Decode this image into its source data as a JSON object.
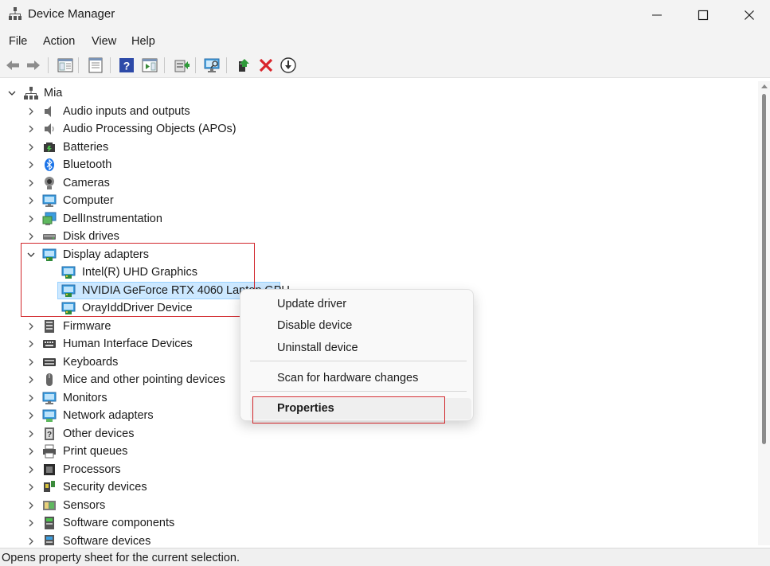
{
  "window": {
    "title": "Device Manager"
  },
  "menu": [
    "File",
    "Action",
    "View",
    "Help"
  ],
  "toolbar": {
    "buttons": [
      "back-arrow-icon",
      "forward-arrow-icon",
      "show-hide-console-tree-icon",
      "properties-sheet-icon",
      "help-icon",
      "action-pane-icon",
      "update-driver-icon",
      "scan-hardware-icon",
      "enable-device-icon",
      "uninstall-x-icon",
      "disable-down-icon"
    ]
  },
  "tree": {
    "root": "Mia",
    "categories": [
      "Audio inputs and outputs",
      "Audio Processing Objects (APOs)",
      "Batteries",
      "Bluetooth",
      "Cameras",
      "Computer",
      "DellInstrumentation",
      "Disk drives",
      "Display adapters",
      "Firmware",
      "Human Interface Devices",
      "Keyboards",
      "Mice and other pointing devices",
      "Monitors",
      "Network adapters",
      "Other devices",
      "Print queues",
      "Processors",
      "Security devices",
      "Sensors",
      "Software components",
      "Software devices"
    ],
    "display_adapters": [
      "Intel(R) UHD Graphics",
      "NVIDIA GeForce RTX 4060 Laptop GPU",
      "OrayIddDriver Device"
    ]
  },
  "context_menu": {
    "items": [
      "Update driver",
      "Disable device",
      "Uninstall device",
      "Scan for hardware changes",
      "Properties"
    ]
  },
  "status": {
    "text": "Opens property sheet for the current selection."
  },
  "colors": {
    "highlight_box": "#d1262b",
    "selection": "#cce8ff",
    "uninstall_x": "#d9252b"
  }
}
